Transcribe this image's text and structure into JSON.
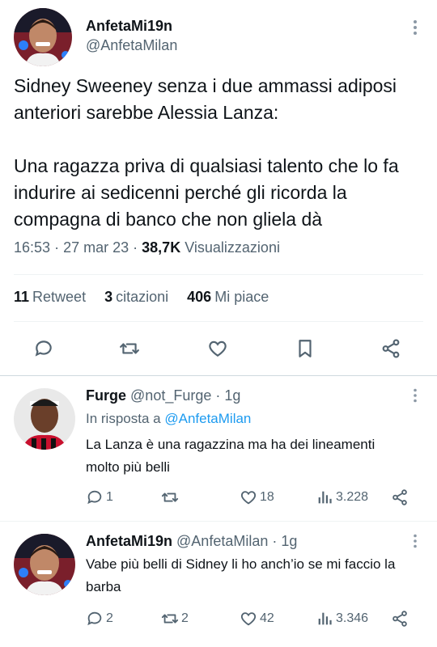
{
  "tweet": {
    "author_name": "AnfetaMi19n",
    "author_handle": "@AnfetaMilan",
    "text": "Sidney Sweeney senza i due ammassi adiposi anteriori sarebbe Alessia Lanza:\n\nUna ragazza priva di qualsiasi talento che lo fa indurire ai sedicenni perché gli ricorda la compagna di banco che non gliela dà",
    "time": "16:53",
    "date": "27 mar 23",
    "views_count": "38,7K",
    "views_label": "Visualizzazioni",
    "sep": "·",
    "stats": {
      "retweets_count": "11",
      "retweets_label": "Retweet",
      "quotes_count": "3",
      "quotes_label": "citazioni",
      "likes_count": "406",
      "likes_label": "Mi piace"
    }
  },
  "replies": [
    {
      "name": "Furge",
      "handle": "@not_Furge",
      "age": "· 1g",
      "reply_to_prefix": "In risposta a",
      "reply_to_handle": "@AnfetaMilan",
      "text": "La Lanza è una ragazzina ma ha dei lineamenti molto più belli",
      "replies": "1",
      "retweets": "",
      "likes": "18",
      "views": "3.228"
    },
    {
      "name": "AnfetaMi19n",
      "handle": "@AnfetaMilan",
      "age": "· 1g",
      "text": "Vabe più belli di Sidney li ho anch’io se mi faccio la barba",
      "replies": "2",
      "retweets": "2",
      "likes": "42",
      "views": "3.346"
    }
  ],
  "colors": {
    "text": "#0f1419",
    "secondary": "#536471",
    "link": "#1d9bf0",
    "divider": "#eff3f4"
  },
  "icons": [
    "reply-icon",
    "retweet-icon",
    "like-icon",
    "bookmark-icon",
    "share-icon",
    "views-icon",
    "more-icon"
  ]
}
